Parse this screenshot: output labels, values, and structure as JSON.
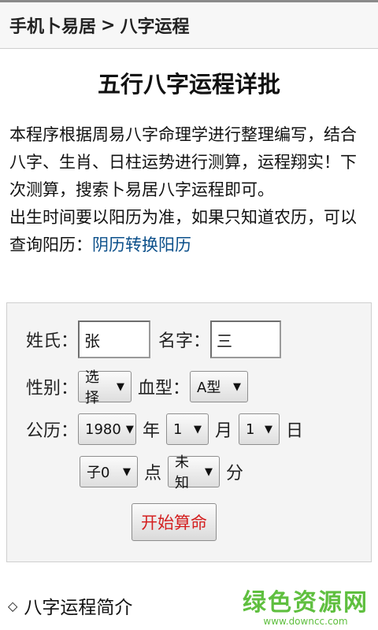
{
  "breadcrumb": {
    "site": "手机卜易居",
    "separator": ">",
    "current": "八字运程"
  },
  "page_title": "五行八字运程详批",
  "intro": {
    "paragraph1": "本程序根据周易八字命理学进行整理编写，结合八字、生肖、日柱运势进行测算，运程翔实！下次测算，搜索卜易居八字运程即可。",
    "paragraph2_prefix": "出生时间要以阳历为准，如果只知道农历，可以查询阳历：",
    "link_text": "阴历转换阳历"
  },
  "form": {
    "surname_label": "姓氏：",
    "surname_value": "张",
    "name_label": "名字：",
    "name_value": "三",
    "gender_label": "性别：",
    "gender_selected": "选择",
    "blood_label": "血型：",
    "blood_selected": "A型",
    "calendar_label": "公历：",
    "year_selected": "1980",
    "year_unit": "年",
    "month_selected": "1",
    "month_unit": "月",
    "day_selected": "1",
    "day_unit": "日",
    "hour_selected": "子0",
    "hour_unit": "点",
    "minute_selected": "未知",
    "minute_unit": "分",
    "submit_label": "开始算命"
  },
  "section": {
    "marker": "◇",
    "title": "八字运程简介"
  },
  "watermark": {
    "cn": "绿色资源网",
    "url": "www.downcc.com"
  },
  "colors": {
    "link": "#0b4f8a",
    "submit_text": "#d42020",
    "watermark": "#5fbf3f"
  }
}
